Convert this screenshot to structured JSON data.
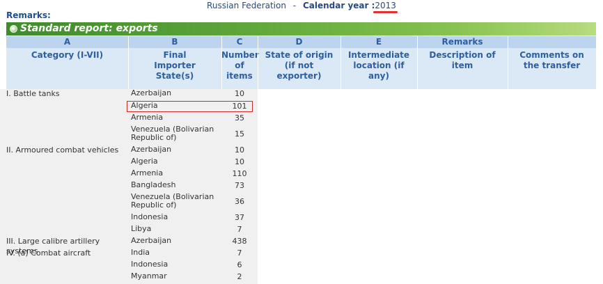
{
  "header": {
    "country": "Russian Federation",
    "separator": "-",
    "calendar_label": "Calendar year :",
    "year": "2013"
  },
  "remarks_label": "Remarks:",
  "report_title": "Standard report: exports",
  "columns": [
    {
      "letter": "A",
      "desc": "Category (I-VII)"
    },
    {
      "letter": "B",
      "desc": "Final Importer State(s)"
    },
    {
      "letter": "C",
      "desc": "Number of items"
    },
    {
      "letter": "D",
      "desc": "State of origin (if not exporter)"
    },
    {
      "letter": "E",
      "desc": "Intermediate location (if any)"
    },
    {
      "letter": "Remarks",
      "desc": "Description of item"
    },
    {
      "letter": "",
      "desc": "Comments on the transfer"
    }
  ],
  "rows": [
    {
      "category": "I. Battle tanks",
      "state": "Azerbaijan",
      "number": "10"
    },
    {
      "category": "",
      "state": "Algeria",
      "number": "101"
    },
    {
      "category": "",
      "state": "Armenia",
      "number": "35"
    },
    {
      "category": "",
      "state": "Venezuela (Bolivarian Republic of)",
      "number": "15"
    },
    {
      "category": "II. Armoured combat vehicles",
      "state": "Azerbaijan",
      "number": "10"
    },
    {
      "category": "",
      "state": "Algeria",
      "number": "10"
    },
    {
      "category": "",
      "state": "Armenia",
      "number": "110"
    },
    {
      "category": "",
      "state": "Bangladesh",
      "number": "73"
    },
    {
      "category": "",
      "state": "Venezuela (Bolivarian Republic of)",
      "number": "36"
    },
    {
      "category": "",
      "state": "Indonesia",
      "number": "37"
    },
    {
      "category": "",
      "state": "Libya",
      "number": "7"
    },
    {
      "category": "III. Large calibre artillery systems",
      "state": "Azerbaijan",
      "number": "438"
    },
    {
      "category": "IV. (a) Combat aircraft",
      "state": "India",
      "number": "7"
    },
    {
      "category": "",
      "state": "Indonesia",
      "number": "6"
    },
    {
      "category": "",
      "state": "Myanmar",
      "number": "2"
    }
  ],
  "colors": {
    "accent": "#2d5fa0",
    "banner": "#5ea63a",
    "highlight": "#d42828"
  }
}
